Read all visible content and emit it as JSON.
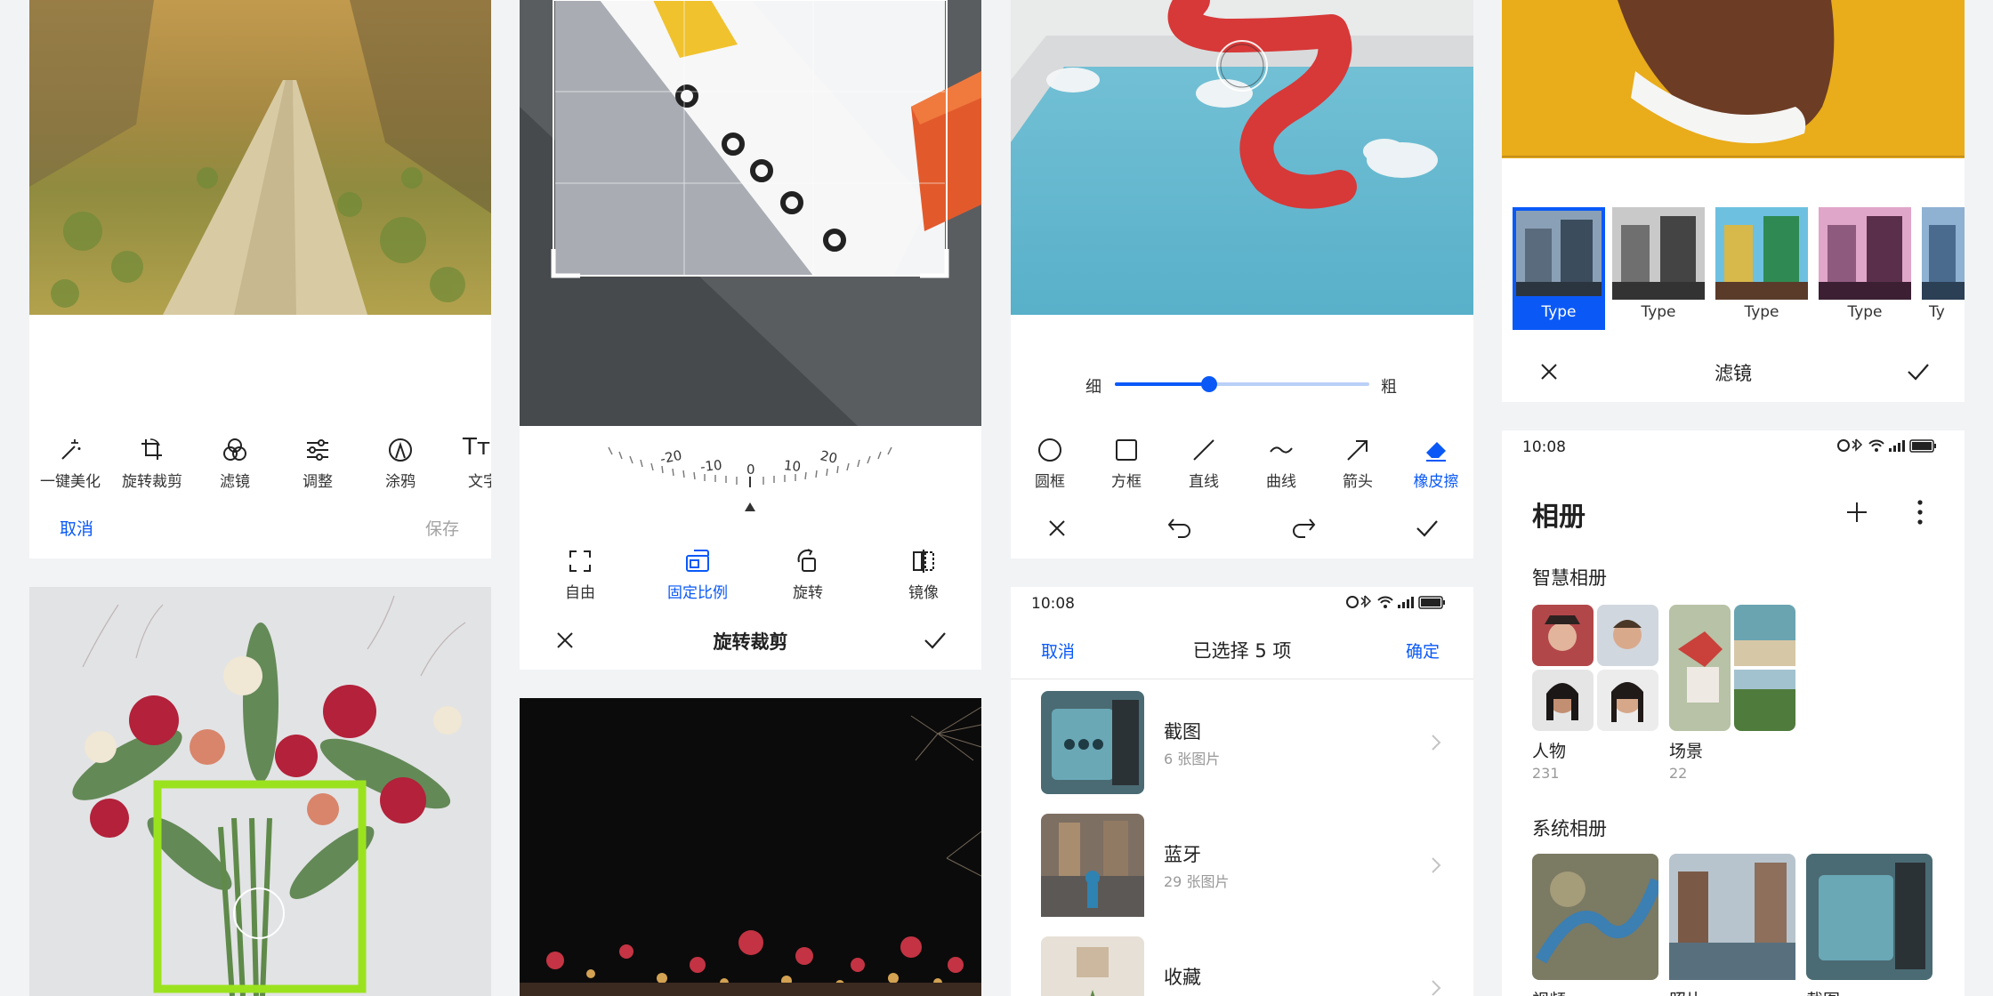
{
  "edit_toolbar": {
    "tools": [
      {
        "label": "一键美化",
        "icon": "magic-wand-icon"
      },
      {
        "label": "旋转裁剪",
        "icon": "crop-rotate-icon"
      },
      {
        "label": "滤镜",
        "icon": "filter-icon"
      },
      {
        "label": "调整",
        "icon": "adjust-sliders-icon"
      },
      {
        "label": "涂鸦",
        "icon": "doodle-pen-icon"
      },
      {
        "label": "文字",
        "icon": "text-icon"
      }
    ],
    "cancel_label": "取消",
    "save_label": "保存"
  },
  "crop": {
    "dial_ticks": [
      "-20",
      "-10",
      "0",
      "10",
      "20"
    ],
    "tools": [
      {
        "label": "自由",
        "icon": "free-crop-icon"
      },
      {
        "label": "固定比例",
        "icon": "fixed-ratio-icon"
      },
      {
        "label": "旋转",
        "icon": "rotate-icon"
      },
      {
        "label": "镜像",
        "icon": "mirror-icon"
      }
    ],
    "selected_tool": "固定比例",
    "title": "旋转裁剪"
  },
  "doodle": {
    "thin_label": "细",
    "thick_label": "粗",
    "brush_size_fraction": 0.37,
    "tools": [
      {
        "label": "圆框",
        "icon": "circle-shape-icon"
      },
      {
        "label": "方框",
        "icon": "square-shape-icon"
      },
      {
        "label": "直线",
        "icon": "line-icon"
      },
      {
        "label": "曲线",
        "icon": "curve-icon"
      },
      {
        "label": "箭头",
        "icon": "arrow-icon"
      },
      {
        "label": "橡皮擦",
        "icon": "eraser-icon"
      }
    ],
    "selected_tool": "橡皮擦"
  },
  "filter": {
    "items": [
      "Type",
      "Type",
      "Type",
      "Type",
      "Ty"
    ],
    "selected_index": 0,
    "title": "滤镜"
  },
  "album_select": {
    "time": "10:08",
    "cancel_label": "取消",
    "title": "已选择 5 项",
    "confirm_label": "确定",
    "albums": [
      {
        "name": "截图",
        "count": "6 张图片"
      },
      {
        "name": "蓝牙",
        "count": "29 张图片"
      },
      {
        "name": "收藏",
        "count": ""
      }
    ]
  },
  "gallery": {
    "time": "10:08",
    "title": "相册",
    "smart_section_title": "智慧相册",
    "smart_albums": [
      {
        "name": "人物",
        "count": "231"
      },
      {
        "name": "场景",
        "count": "22"
      }
    ],
    "system_section_title": "系统相册",
    "system_albums": [
      {
        "name": "视频"
      },
      {
        "name": "照片"
      },
      {
        "name": "截图"
      }
    ]
  },
  "colors": {
    "accent": "#0a59f7",
    "doodle_red": "#d73838",
    "crop_green": "#9be21e"
  }
}
